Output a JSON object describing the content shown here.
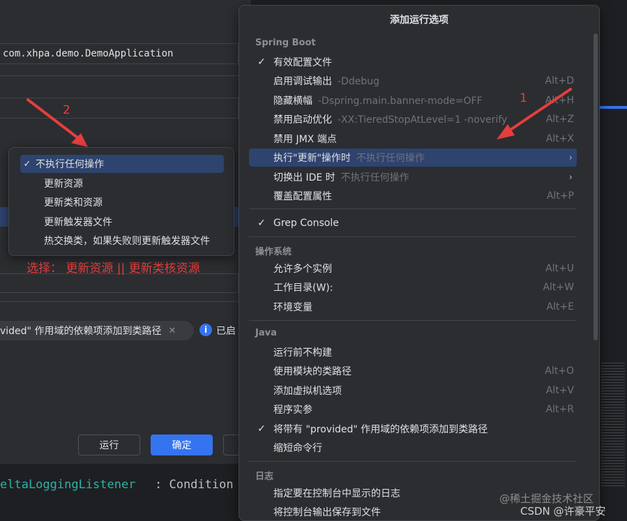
{
  "background_dialog": {
    "main_class": "com.xhpa.demo.DemoApplication",
    "provided_tag": "vided\" 作用域的依赖项添加到类路径",
    "enabled_text": "已启",
    "run_button": "运行",
    "ok_button": "确定"
  },
  "console": {
    "line": "eltaLoggingListener",
    "line_suffix": ": Condition"
  },
  "annotations": {
    "num_1": "1",
    "num_2": "2",
    "choice_text": "选择： 更新资源 || 更新类核资源"
  },
  "submenu": {
    "items": [
      {
        "label": "不执行任何操作",
        "checked": "✓"
      },
      {
        "label": "更新资源"
      },
      {
        "label": "更新类和资源"
      },
      {
        "label": "更新触发器文件"
      },
      {
        "label": "热交换类，如果失败则更新触发器文件"
      }
    ]
  },
  "popup": {
    "title": "添加运行选项",
    "sections": [
      {
        "header": "Spring Boot",
        "items": [
          {
            "label": "有效配置文件",
            "check": "✓"
          },
          {
            "label": "启用调试输出",
            "hint": "-Ddebug",
            "shortcut": "Alt+D"
          },
          {
            "label": "隐藏横幅",
            "hint": "-Dspring.main.banner-mode=OFF",
            "shortcut": "Alt+H"
          },
          {
            "label": "禁用启动优化",
            "hint": "-XX:TieredStopAtLevel=1 -noverify",
            "shortcut": "Alt+Z"
          },
          {
            "label": "禁用 JMX 端点",
            "shortcut": "Alt+X"
          },
          {
            "label": "执行\"更新\"操作时",
            "hint": "不执行任何操作",
            "arrow": "›"
          },
          {
            "label": "切换出 IDE 时",
            "hint": "不执行任何操作",
            "arrow": "›"
          },
          {
            "label": "覆盖配置属性",
            "shortcut": "Alt+P"
          }
        ]
      },
      {
        "header": "",
        "items": [
          {
            "label": "Grep Console",
            "check": "✓"
          }
        ]
      },
      {
        "header": "操作系统",
        "items": [
          {
            "label": "允许多个实例",
            "shortcut": "Alt+U"
          },
          {
            "label": "工作目录(W):",
            "shortcut": "Alt+W"
          },
          {
            "label": "环境变量",
            "shortcut": "Alt+E"
          }
        ]
      },
      {
        "header": "Java",
        "items": [
          {
            "label": "运行前不构建"
          },
          {
            "label": "使用模块的类路径",
            "shortcut": "Alt+O"
          },
          {
            "label": "添加虚拟机选项",
            "shortcut": "Alt+V"
          },
          {
            "label": "程序实参",
            "shortcut": "Alt+R"
          },
          {
            "label": "将带有 \"provided\" 作用域的依赖项添加到类路径",
            "check": "✓"
          },
          {
            "label": "缩短命令行"
          }
        ]
      },
      {
        "header": "日志",
        "items": [
          {
            "label": "指定要在控制台中显示的日志"
          },
          {
            "label": "将控制台输出保存到文件"
          }
        ]
      }
    ]
  },
  "watermark": {
    "line1": "@稀土掘金技术社区",
    "line2": "CSDN @许豪平安"
  },
  "colors": {
    "accent": "#3574f0",
    "highlight": "#2e436e",
    "annotation_red": "#e53e3e"
  }
}
